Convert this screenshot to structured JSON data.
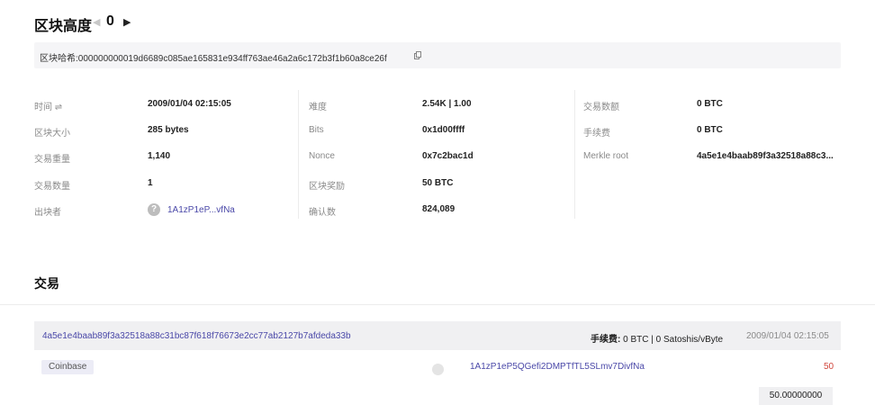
{
  "header": {
    "title": "区块高度",
    "height": "0"
  },
  "hash_bar": {
    "text": "区块哈希:000000000019d6689c085ae165831e934ff763ae46a2a6c172b3f1b60a8ce26f"
  },
  "details": {
    "col1": [
      {
        "label": "时间 ⇌",
        "value": "2009/01/04 02:15:05"
      },
      {
        "label": "区块大小",
        "value": "285 bytes"
      },
      {
        "label": "交易重量",
        "value": "1,140"
      },
      {
        "label": "交易数量",
        "value": "1"
      },
      {
        "label": "出块者",
        "value": "1A1zP1eP...vfNa"
      }
    ],
    "col2": [
      {
        "label": "难度",
        "value": "2.54K | 1.00"
      },
      {
        "label": "Bits",
        "value": "0x1d00ffff"
      },
      {
        "label": "Nonce",
        "value": "0x7c2bac1d"
      },
      {
        "label": "区块奖励",
        "value": "50 BTC"
      },
      {
        "label": "确认数",
        "value": "824,089"
      }
    ],
    "col3": [
      {
        "label": "交易数额",
        "value": "0 BTC"
      },
      {
        "label": "手续费",
        "value": "0 BTC"
      },
      {
        "label": "Merkle root",
        "value": "4a5e1e4baab89f3a32518a88c3..."
      }
    ]
  },
  "transactions": {
    "title": "交易",
    "tx": {
      "hash": "4a5e1e4baab89f3a32518a88c31bc87f618f76673e2cc77ab2127b7afdeda33b",
      "fee_label": "手续费:",
      "fee_rest": " 0 BTC | 0 Satoshis/vByte",
      "time": "2009/01/04 02:15:05",
      "input": "Coinbase",
      "output_address": "1A1zP1eP5QGefi2DMPTfTL5SLmv7DivfNa",
      "output_amount": "50",
      "total": "50.00000000"
    }
  },
  "icons": {
    "prev": "caret-left-icon",
    "next": "caret-right-icon",
    "copy": "copy-icon",
    "miner": "question-circle-icon"
  },
  "colors": {
    "link": "#4a48a8",
    "amount": "#d0443a",
    "bar_bg": "#f5f5f7"
  }
}
